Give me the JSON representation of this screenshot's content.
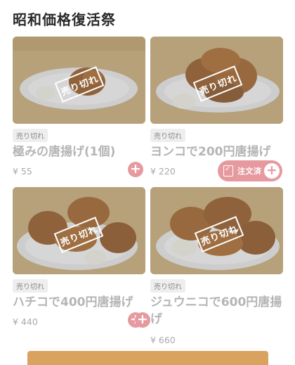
{
  "header": {
    "title": "昭和価格復活祭"
  },
  "sold_out_stamp": "売り切れ",
  "items": [
    {
      "badge": "売り切れ",
      "name": "極みの唐揚げ(1個)",
      "price": "¥ 55"
    },
    {
      "badge": "売り切れ",
      "name": "ヨンコで200円唐揚げ",
      "price": "¥ 220",
      "ordered_label": "注文済"
    },
    {
      "badge": "売り切れ",
      "name": "ハチコで400円唐揚げ",
      "price": "¥ 440"
    },
    {
      "badge": "売り切れ",
      "name": "ジュウニコで600円唐揚げ",
      "price": "¥ 660"
    }
  ],
  "colors": {
    "accent": "#e69aa0",
    "disabled_text": "#b5b5b5",
    "badge_bg": "#eeeeee"
  },
  "icons": {
    "add": "plus-icon",
    "ordered": "order-doc-icon"
  }
}
